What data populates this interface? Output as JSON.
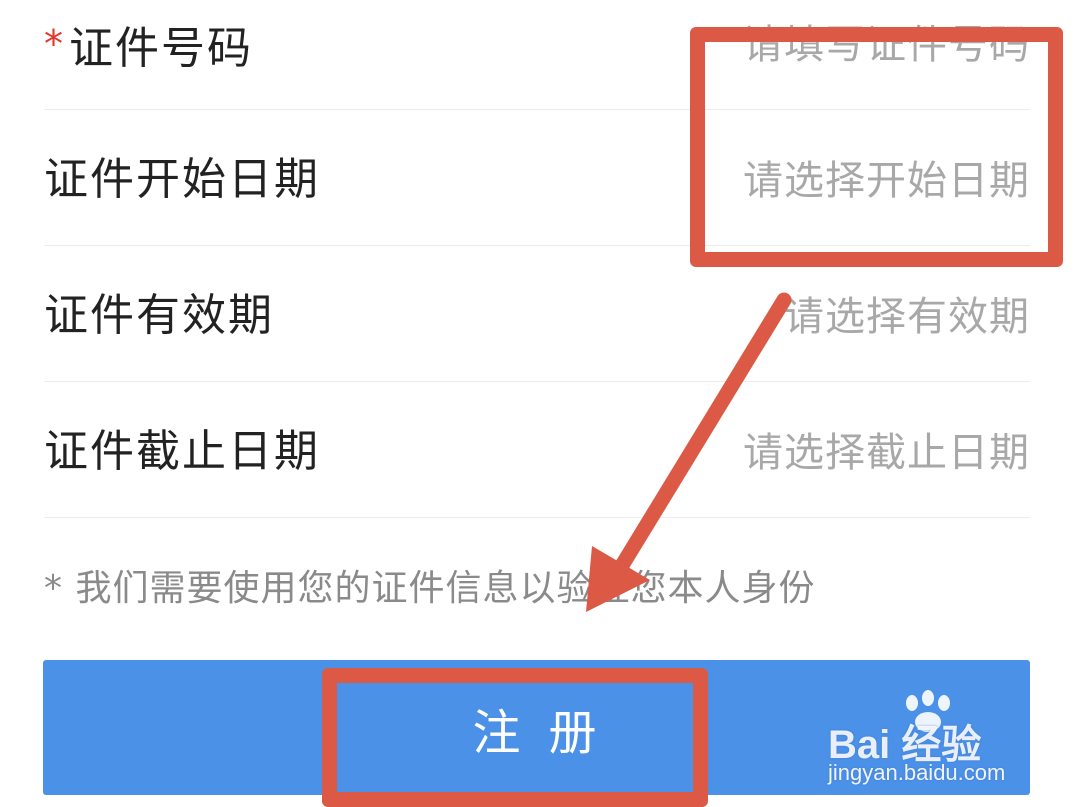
{
  "form": {
    "fields": [
      {
        "label": "证件号码",
        "required_mark": "*",
        "placeholder": "请填写证件号码"
      },
      {
        "label": "证件开始日期",
        "placeholder": "请选择开始日期"
      },
      {
        "label": "证件有效期",
        "placeholder": "请选择有效期"
      },
      {
        "label": "证件截止日期",
        "placeholder": "请选择截止日期"
      }
    ],
    "notice": "* 我们需要使用您的证件信息以验证您本人身份"
  },
  "register_button": {
    "label": "注册"
  },
  "annotation": {
    "color": "#dc5a45"
  },
  "watermark": {
    "logo": "Bai 经验",
    "url": "jingyan.baidu.com"
  },
  "colors": {
    "button": "#4c91e8",
    "required": "#e5352d",
    "placeholder": "#a8a8a8",
    "label": "#222222"
  }
}
